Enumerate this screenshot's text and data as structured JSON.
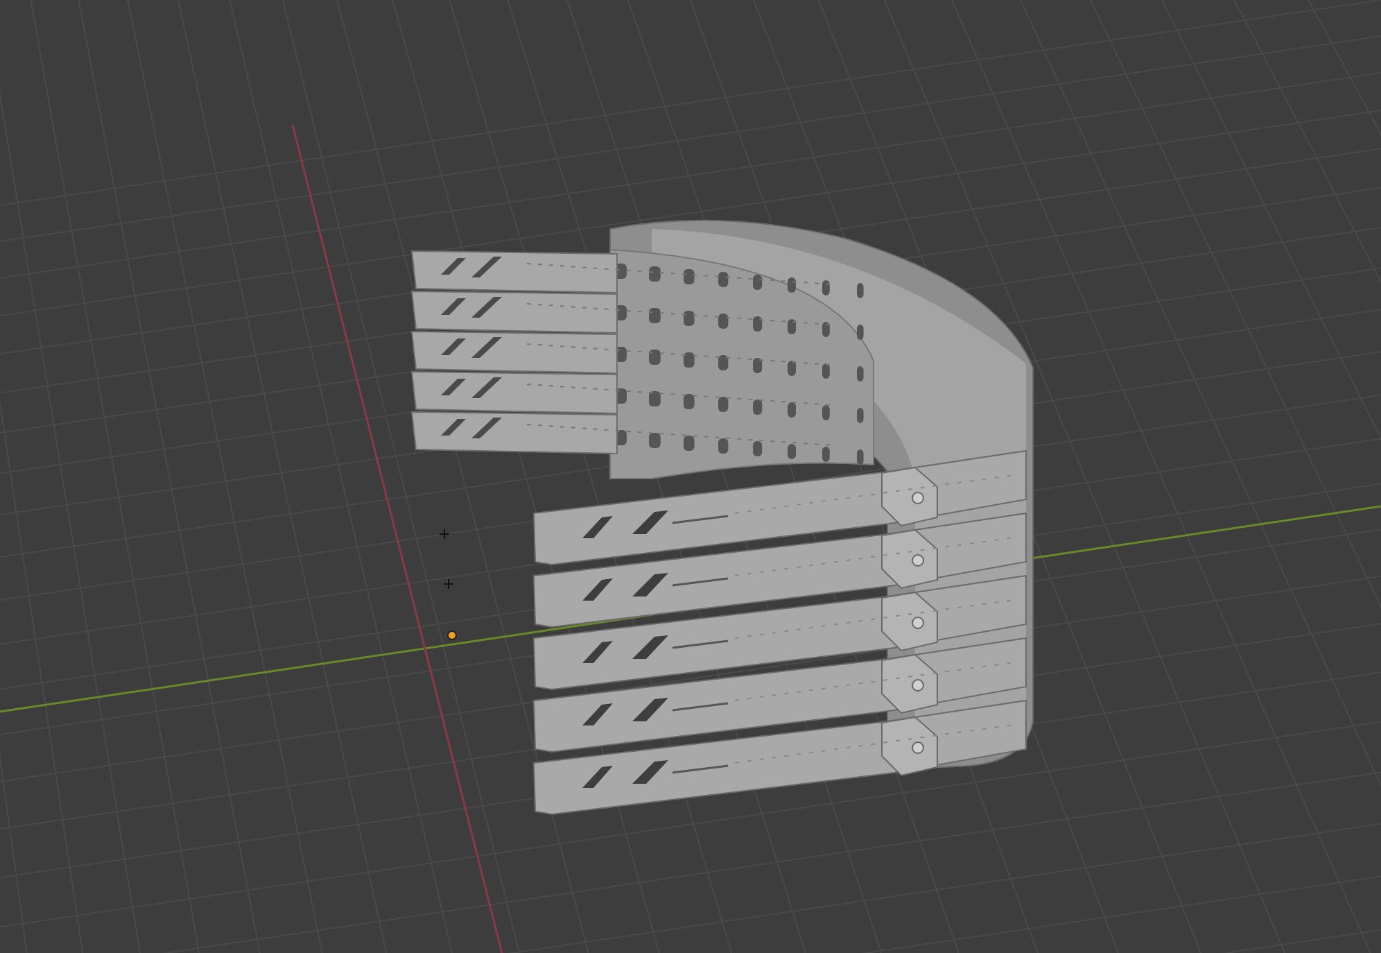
{
  "viewport": {
    "grid": true,
    "axes": true,
    "origin": true
  }
}
